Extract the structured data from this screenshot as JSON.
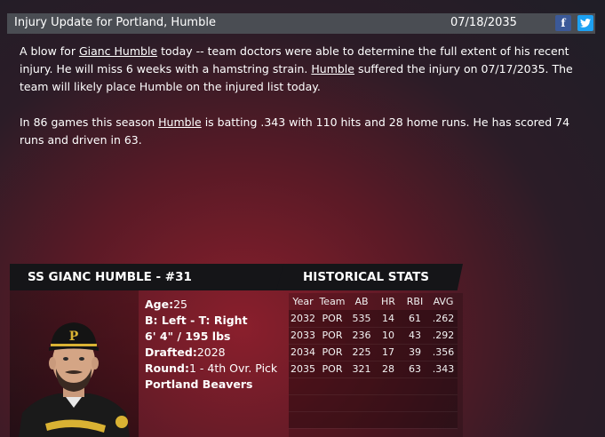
{
  "header": {
    "title": "Injury Update for Portland, Humble",
    "date": "07/18/2035",
    "facebook_icon": "f",
    "twitter_icon": "🐦"
  },
  "article": {
    "p1": {
      "t1": "A blow for ",
      "link1": "Gianc Humble",
      "t2": " today -- team doctors were able to determine the full extent of his recent injury. He will miss 6 weeks with a hamstring strain. ",
      "link2": "Humble",
      "t3": " suffered the injury on 07/17/2035. The team will likely place Humble on the injured list today."
    },
    "p2": {
      "t1": "In 86 games this season ",
      "link1": "Humble",
      "t2": " is batting .343 with 110 hits and 28 home runs. He has scored 74 runs and driven in 63."
    }
  },
  "player": {
    "name_header": "SS GIANC HUMBLE - #31",
    "age_label": "Age:",
    "age": "25",
    "bats_throws": "B: Left - T: Right",
    "height_weight": "6' 4\" / 195 lbs",
    "drafted_label": "Drafted:",
    "drafted": "2028",
    "round_label": "Round:",
    "round": "1 - 4th Ovr. Pick",
    "team": "Portland Beavers"
  },
  "stats": {
    "header": "HISTORICAL STATS",
    "columns": [
      "Year",
      "Team",
      "AB",
      "HR",
      "RBI",
      "AVG"
    ],
    "rows": [
      [
        "2032",
        "POR",
        "535",
        "14",
        "61",
        ".262"
      ],
      [
        "2033",
        "POR",
        "236",
        "10",
        "43",
        ".292"
      ],
      [
        "2034",
        "POR",
        "225",
        "17",
        "39",
        ".356"
      ],
      [
        "2035",
        "POR",
        "321",
        "28",
        "63",
        ".343"
      ]
    ]
  },
  "colors": {
    "header_bg": "#4a4d53",
    "facebook": "#3b5998",
    "twitter": "#1da1f2",
    "bar_bg": "#151518"
  }
}
